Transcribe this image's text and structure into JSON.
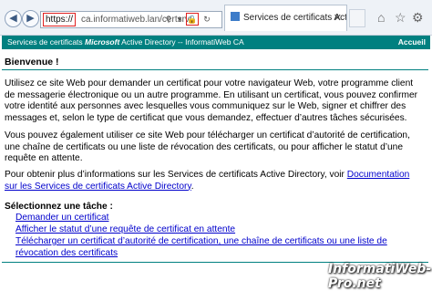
{
  "browser": {
    "address_protocol": "https://",
    "address_host": "ca.informatiweb.lan/certsrv/",
    "tab_title": "Services de certificats Active..."
  },
  "banner": {
    "title_prefix": "Services de certificats ",
    "title_brand": "Microsoft",
    "title_suffix": " Active Directory  --  InformatiWeb CA",
    "home_link": "Accueil"
  },
  "page": {
    "welcome": "Bienvenue !",
    "paragraph1": "Utilisez ce site Web pour demander un certificat pour votre navigateur Web, votre programme client de messagerie électronique ou un autre programme. En utilisant un certificat, vous pouvez confirmer votre identité aux personnes avec lesquelles vous communiquez sur le Web, signer et chiffrer des messages et, selon le type de certificat que vous demandez, effectuer d’autres tâches sécurisées.",
    "paragraph2": "Vous pouvez également utiliser ce site Web pour télécharger un certificat d’autorité de certification, une chaîne de certificats ou une liste de révocation des certificats, ou pour afficher le statut d’une requête en attente.",
    "paragraph3_text": "Pour obtenir plus d’informations sur les Services de certificats Active Directory, voir ",
    "paragraph3_link": "Documentation sur les Services de certificats Active Directory",
    "paragraph3_end": ".",
    "task_heading": "Sélectionnez une tâche :",
    "tasks": [
      "Demander un certificat",
      "Afficher le statut d’une requête de certificat en attente",
      "Télécharger un certificat d’autorité de certification, une chaîne de certificats ou une liste de révocation des certificats"
    ]
  },
  "watermark": "InformatiWeb-Pro.net"
}
